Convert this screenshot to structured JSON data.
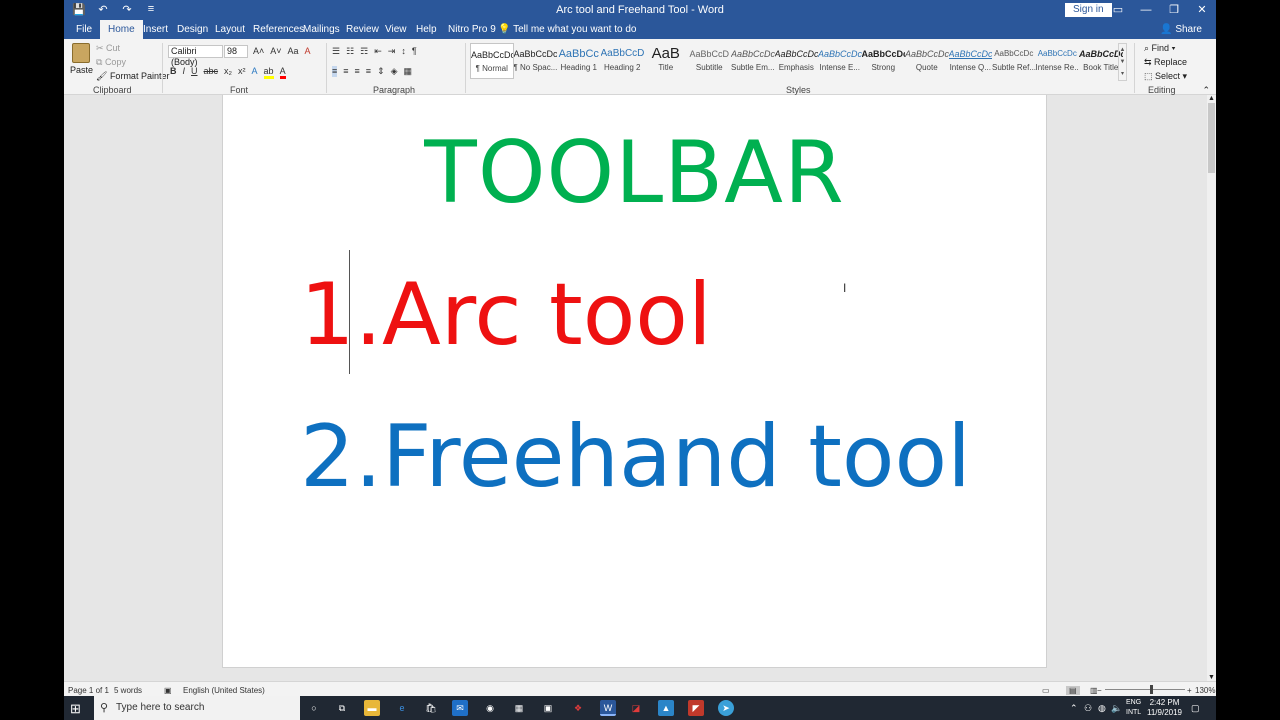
{
  "window": {
    "title": "Arc tool and Freehand Tool  -  Word",
    "signin": "Sign in",
    "controls": [
      "▭",
      "—",
      "❐",
      "✕"
    ]
  },
  "qat": [
    "💾",
    "↶",
    "↷",
    "≡"
  ],
  "tabs": [
    "File",
    "Home",
    "Insert",
    "Design",
    "Layout",
    "References",
    "Mailings",
    "Review",
    "View",
    "Help",
    "Nitro Pro 9"
  ],
  "tell_me": "Tell me what you want to do",
  "share": "Share",
  "clipboard": {
    "paste": "Paste",
    "cut": "Cut",
    "copy": "Copy",
    "format_painter": "Format Painter",
    "label": "Clipboard"
  },
  "font": {
    "name": "Calibri (Body)",
    "size": "98",
    "grow": "A˄",
    "shrink": "A˅",
    "case": "Aa",
    "clear": "A",
    "bold": "B",
    "italic": "I",
    "underline": "U",
    "strike": "abc",
    "sub": "x₂",
    "sup": "x²",
    "label": "Font"
  },
  "paragraph": {
    "label": "Paragraph",
    "show_marks": "¶"
  },
  "styles": {
    "label": "Styles",
    "items": [
      {
        "preview": "AaBbCcDc",
        "name": "¶ Normal"
      },
      {
        "preview": "AaBbCcDc",
        "name": "¶ No Spac..."
      },
      {
        "preview": "AaBbCc",
        "name": "Heading 1"
      },
      {
        "preview": "AaBbCcD",
        "name": "Heading 2"
      },
      {
        "preview": "AaB",
        "name": "Title"
      },
      {
        "preview": "AaBbCcD",
        "name": "Subtitle"
      },
      {
        "preview": "AaBbCcDc",
        "name": "Subtle Em..."
      },
      {
        "preview": "AaBbCcDc",
        "name": "Emphasis"
      },
      {
        "preview": "AaBbCcDc",
        "name": "Intense E..."
      },
      {
        "preview": "AaBbCcDc",
        "name": "Strong"
      },
      {
        "preview": "AaBbCcDc",
        "name": "Quote"
      },
      {
        "preview": "AaBbCcDc",
        "name": "Intense Q..."
      },
      {
        "preview": "AaBbCcDc",
        "name": "Subtle Ref..."
      },
      {
        "preview": "AaBbCcDc",
        "name": "Intense Re..."
      },
      {
        "preview": "AaBbCcDc",
        "name": "Book Title"
      }
    ]
  },
  "editing": {
    "find": "Find",
    "replace": "Replace",
    "select": "Select",
    "label": "Editing"
  },
  "document": {
    "heading": "TOOLBAR",
    "line1": "1.Arc tool",
    "line2": "2.Freehand tool"
  },
  "status": {
    "page": "Page 1 of 1",
    "words": "5 words",
    "language": "English (United States)",
    "zoom": "130%"
  },
  "taskbar": {
    "search_placeholder": "Type here to search",
    "lang_top": "ENG",
    "lang_bottom": "INTL",
    "time": "2:42 PM",
    "date": "11/9/2019"
  },
  "colors": {
    "word_blue": "#2b579a",
    "heading_green": "#00b050",
    "line1_red": "#ee1111",
    "line2_blue": "#0e70c0"
  }
}
